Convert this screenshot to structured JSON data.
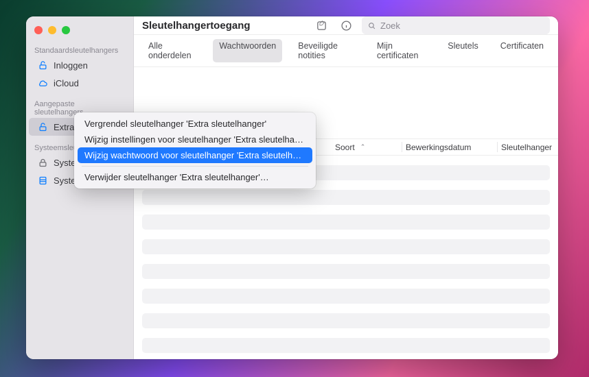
{
  "window": {
    "title": "Sleutelhangertoegang"
  },
  "sidebar": {
    "sections": [
      {
        "label": "Standaardsleutelhangers",
        "items": [
          {
            "label": "Inloggen",
            "icon": "unlock"
          },
          {
            "label": "iCloud",
            "icon": "cloud"
          }
        ]
      },
      {
        "label": "Aangepaste sleutelhangers",
        "items": [
          {
            "label": "Extra sleutelhanger",
            "icon": "unlock",
            "selected": true
          }
        ]
      },
      {
        "label": "Systeemsleutelhangers",
        "items": [
          {
            "label": "Systeem",
            "icon": "lock"
          },
          {
            "label": "Systeem",
            "icon": "cabinet"
          }
        ]
      }
    ]
  },
  "search": {
    "placeholder": "Zoek"
  },
  "tabs": [
    {
      "label": "Alle onderdelen"
    },
    {
      "label": "Wachtwoorden",
      "active": true
    },
    {
      "label": "Beveiligde notities"
    },
    {
      "label": "Mijn certificaten"
    },
    {
      "label": "Sleutels"
    },
    {
      "label": "Certificaten"
    }
  ],
  "columns": {
    "kind": "Soort",
    "date": "Bewerkingsdatum",
    "chain": "Sleutelhanger"
  },
  "context_menu": {
    "items": [
      {
        "label": "Vergrendel sleutelhanger 'Extra sleutelhanger'"
      },
      {
        "label": "Wijzig instellingen voor sleutelhanger 'Extra sleutelhanger'…"
      },
      {
        "label": "Wijzig wachtwoord voor sleutelhanger 'Extra sleutelhanger'…",
        "highlight": true
      },
      {
        "sep": true
      },
      {
        "label": "Verwijder sleutelhanger 'Extra sleutelhanger'…"
      }
    ]
  }
}
